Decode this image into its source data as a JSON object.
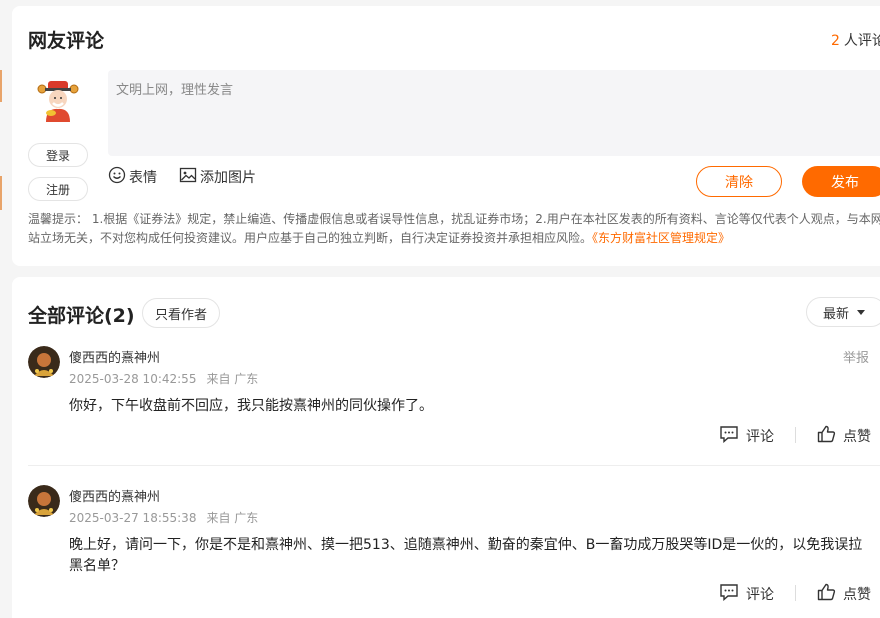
{
  "top": {
    "title": "网友评论",
    "count": "2",
    "count_suffix": "人评论",
    "login_label": "登录",
    "register_label": "注册",
    "input_placeholder": "文明上网，理性发言",
    "emoji_label": "表情",
    "image_label": "添加图片",
    "clear_label": "清除",
    "post_label": "发布",
    "notice_text": "温馨提示：  1.根据《证券法》规定，禁止编造、传播虚假信息或者误导性信息，扰乱证券市场；2.用户在本社区发表的所有资料、言论等仅代表个人观点，与本网站立场无关，不对您构成任何投资建议。用户应基于自己的独立判断，自行决定证券投资并承担相应风险。",
    "notice_link": "《东方财富社区管理规定》"
  },
  "list": {
    "title": "全部评论(2)",
    "filter_label": "只看作者",
    "sort_label": "最新",
    "report_label": "举报",
    "comment_label": "评论",
    "like_label": "点赞",
    "comments": [
      {
        "user": "傻西西的熹神州",
        "time": "2025-03-28 10:42:55",
        "location": "来自 广东",
        "text": "你好，下午收盘前不回应，我只能按熹神州的同伙操作了。"
      },
      {
        "user": "傻西西的熹神州",
        "time": "2025-03-27 18:55:38",
        "location": "来自 广东",
        "text": "晚上好，请问一下，你是不是和熹神州、摸一把513、追随熹神州、勤奋的秦宜仲、B一畜功成万股哭等ID是一伙的，以免我误拉黑名单？"
      }
    ]
  },
  "colors": {
    "accent": "#ff6a00",
    "background": "#f5f5f5",
    "card": "#ffffff",
    "muted": "#999999"
  },
  "icons": [
    "mascot-avatar-icon",
    "emoji-icon",
    "image-icon",
    "comment-icon",
    "like-icon",
    "caret-down-icon",
    "user-avatar-icon"
  ]
}
